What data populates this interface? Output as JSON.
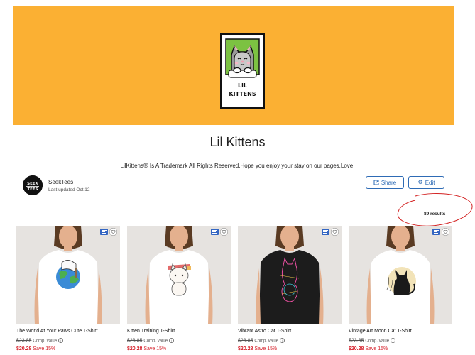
{
  "collection": {
    "logo_text": [
      "LiL",
      "KITTENS"
    ],
    "title": "Lil Kittens",
    "description_part1": "LilKittens",
    "description_symbol": "©",
    "description_part2": " Is A Trademark All Rights Reserved.Hope you enjoy your stay on our pages.Love.",
    "banner_color": "#fbb033"
  },
  "owner": {
    "name": "SeekTees",
    "updated": "Last updated Oct 12",
    "avatar_text": [
      "SEEK",
      "TEES"
    ]
  },
  "actions": {
    "share_label": "Share",
    "edit_label": "Edit",
    "share_icon": "share-icon",
    "edit_icon": "gear-icon",
    "accent": "#2e6bb5"
  },
  "results_label": "89 results",
  "products": [
    {
      "name": "The World At Your Paws Cute T-Shirt",
      "comp_price": "$23.85",
      "comp_label": "Comp. value",
      "price": "$20.28",
      "save": "Save 15%",
      "shirt_color": "#ffffff",
      "theme": "globe-cat"
    },
    {
      "name": "Kitten Training T-Shirt",
      "comp_price": "$23.85",
      "comp_label": "Comp. value",
      "price": "$20.28",
      "save": "Save 15%",
      "shirt_color": "#ffffff",
      "theme": "headband-cat"
    },
    {
      "name": "Vibrant Astro Cat T-Shirt",
      "comp_price": "$23.85",
      "comp_label": "Comp. value",
      "price": "$20.28",
      "save": "Save 15%",
      "shirt_color": "#1c1c1c",
      "theme": "neon-cat"
    },
    {
      "name": "Vintage Art Moon Cat T-Shirt",
      "comp_price": "$23.85",
      "comp_label": "Comp. value",
      "price": "$20.28",
      "save": "Save 15%",
      "shirt_color": "#ffffff",
      "theme": "moon-cat"
    }
  ],
  "sale_color": "#d6202a"
}
